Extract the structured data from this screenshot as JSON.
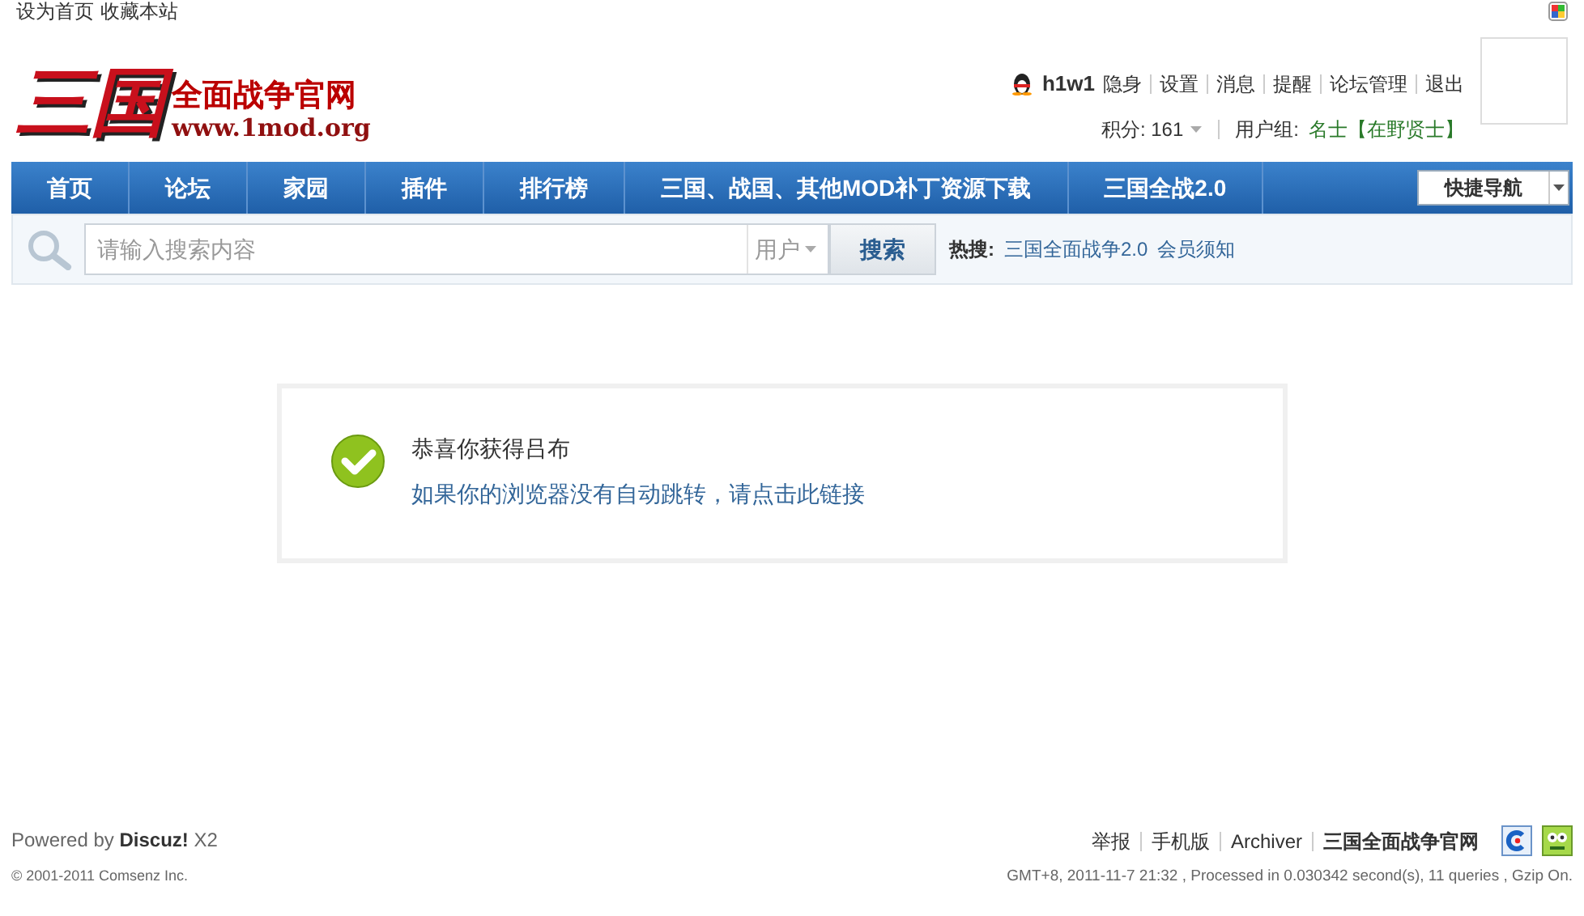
{
  "top_links": [
    "设为首页",
    "收藏本站"
  ],
  "logo": {
    "mark": "三国",
    "title": "全面战争官网",
    "url": "www.1mod.org"
  },
  "user": {
    "name": "h1w1",
    "links": [
      "隐身",
      "设置",
      "消息",
      "提醒",
      "论坛管理",
      "退出"
    ],
    "credits_label": "积分: 161",
    "group_label": "用户组:",
    "group": "名士【在野贤士】"
  },
  "nav": {
    "items": [
      {
        "label": "首页",
        "selected": false
      },
      {
        "label": "论坛",
        "selected": false
      },
      {
        "label": "家园",
        "selected": false
      },
      {
        "label": "插件",
        "selected": false
      },
      {
        "label": "排行榜",
        "selected": false
      },
      {
        "label": "三国、战国、其他MOD补丁资源下载",
        "selected": false
      },
      {
        "label": "三国全战2.0",
        "selected": false
      }
    ],
    "quick_nav": "快捷导航"
  },
  "search": {
    "placeholder": "请输入搜索内容",
    "scope": "用户",
    "button": "搜索",
    "hot_label": "热搜:",
    "hot": [
      "三国全面战争2.0",
      "会员须知"
    ]
  },
  "message": {
    "title": "恭喜你获得吕布",
    "link": "如果你的浏览器没有自动跳转，请点击此链接"
  },
  "footer": {
    "powered_prefix": "Powered by",
    "powered_brand": "Discuz!",
    "powered_version": "X2",
    "copyright": "© 2001-2011 Comsenz Inc.",
    "links": [
      "举报",
      "手机版",
      "Archiver"
    ],
    "site": "三国全面战争官网",
    "stats": "GMT+8, 2011-11-7 21:32 , Processed in 0.030342 second(s), 11 queries , Gzip On."
  }
}
